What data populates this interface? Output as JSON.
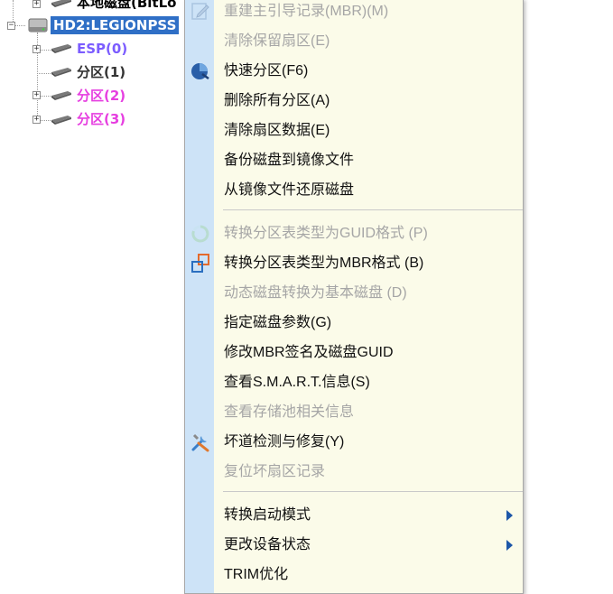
{
  "tree": {
    "items": [
      {
        "label": "本地磁盘(BitLo",
        "color": "#a0522d"
      },
      {
        "label": "HD2:LEGIONPSS",
        "color": "#ffffff",
        "selected": true
      },
      {
        "label": "ESP(0)",
        "color": "#7b5cff"
      },
      {
        "label": "分区(1)",
        "color": "#333333"
      },
      {
        "label": "分区(2)",
        "color": "#e63fe0"
      },
      {
        "label": "分区(3)",
        "color": "#e63fe0"
      }
    ]
  },
  "menu": {
    "items": [
      {
        "label": "重建主引导记录(MBR)(M)",
        "disabled": true,
        "icon": "edit-icon"
      },
      {
        "label": "清除保留扇区(E)",
        "disabled": true
      },
      {
        "label": "快速分区(F6)",
        "disabled": false,
        "icon": "quick-partition-icon"
      },
      {
        "label": "删除所有分区(A)",
        "disabled": false
      },
      {
        "label": "清除扇区数据(E)",
        "disabled": false
      },
      {
        "label": "备份磁盘到镜像文件",
        "disabled": false
      },
      {
        "label": "从镜像文件还原磁盘",
        "disabled": false
      },
      {
        "label": "转换分区表类型为GUID格式 (P)",
        "disabled": true,
        "icon": "convert-guid-icon"
      },
      {
        "label": "转换分区表类型为MBR格式 (B)",
        "disabled": false,
        "icon": "convert-mbr-icon"
      },
      {
        "label": "动态磁盘转换为基本磁盘 (D)",
        "disabled": true
      },
      {
        "label": "指定磁盘参数(G)",
        "disabled": false
      },
      {
        "label": "修改MBR签名及磁盘GUID",
        "disabled": false
      },
      {
        "label": "查看S.M.A.R.T.信息(S)",
        "disabled": false
      },
      {
        "label": "查看存储池相关信息",
        "disabled": true
      },
      {
        "label": "坏道检测与修复(Y)",
        "disabled": false,
        "icon": "tools-icon"
      },
      {
        "label": "复位坏扇区记录",
        "disabled": true
      },
      {
        "label": "转换启动模式",
        "disabled": false,
        "submenu": true
      },
      {
        "label": "更改设备状态",
        "disabled": false,
        "submenu": true
      },
      {
        "label": "TRIM优化",
        "disabled": false
      }
    ]
  },
  "colors": {
    "menu_bg": "#fbfbe9",
    "gutter": "#cde3f7",
    "selection": "#2f6fc6",
    "disabled_text": "#a6a6a6"
  }
}
